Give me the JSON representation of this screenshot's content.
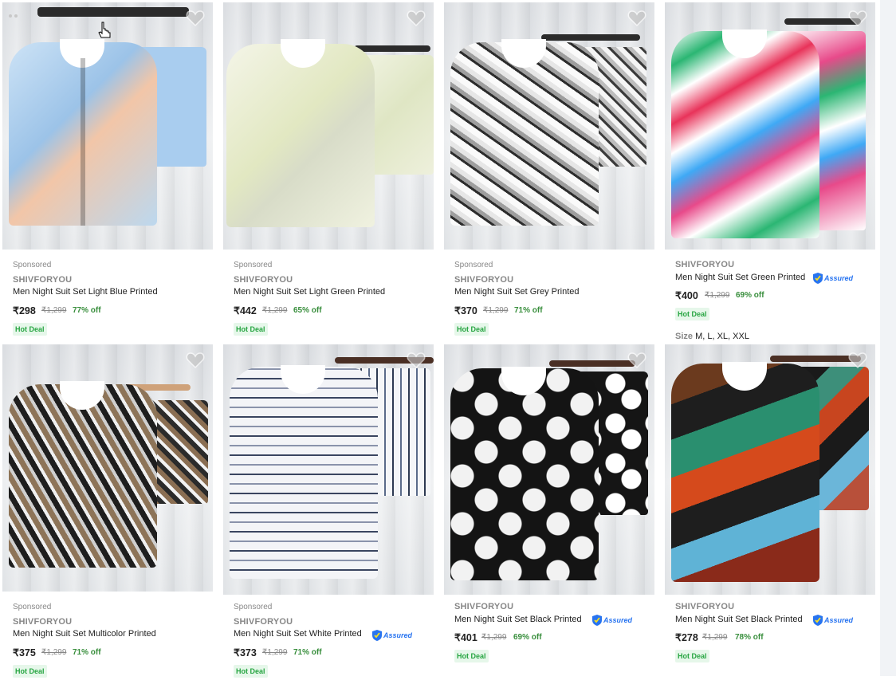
{
  "products": [
    {
      "sponsored": "Sponsored",
      "brand": "SHIVFORYOU",
      "title": "Men Night Suit Set Light Blue Printed",
      "price": "₹298",
      "mrp": "₹1,299",
      "off": "77% off",
      "deal": "Hot Deal",
      "assured": "",
      "shirt_color": "#bcd8ef",
      "shorts_color": "#a9cdef"
    },
    {
      "sponsored": "Sponsored",
      "brand": "SHIVFORYOU",
      "title": "Men Night Suit Set Light Green Printed",
      "price": "₹442",
      "mrp": "₹1,299",
      "off": "65% off",
      "deal": "Hot Deal",
      "assured": "",
      "shirt_color": "#eef0dc",
      "shorts_color": "#e8ecd6"
    },
    {
      "sponsored": "Sponsored",
      "brand": "SHIVFORYOU",
      "title": "Men Night Suit Set Grey Printed",
      "price": "₹370",
      "mrp": "₹1,299",
      "off": "71% off",
      "deal": "Hot Deal",
      "assured": "",
      "shirt_color": "#d6d6d6",
      "shorts_color": "#c9c9c9"
    },
    {
      "sponsored": "",
      "brand": "SHIVFORYOU",
      "title": "Men Night Suit Set Green Printed",
      "price": "₹400",
      "mrp": "₹1,299",
      "off": "69% off",
      "deal": "Hot Deal",
      "assured": "Assured",
      "shirt_color": "#f1f4f2",
      "shorts_color": "#f3f3f3",
      "size_label": "Size",
      "sizes": "M, L, XL, XXL"
    },
    {
      "sponsored": "Sponsored",
      "brand": "SHIVFORYOU",
      "title": "Men Night Suit Set Multicolor Printed",
      "price": "₹375",
      "mrp": "₹1,299",
      "off": "71% off",
      "deal": "Hot Deal",
      "assured": "",
      "shirt_color": "#6e6e6e",
      "shorts_color": "#8a7a66"
    },
    {
      "sponsored": "Sponsored",
      "brand": "SHIVFORYOU",
      "title": "Men Night Suit Set White Printed",
      "price": "₹373",
      "mrp": "₹1,299",
      "off": "71% off",
      "deal": "Hot Deal",
      "assured": "Assured",
      "shirt_color": "#e5e6ea",
      "shorts_color": "#e5e6ea"
    },
    {
      "sponsored": "",
      "brand": "SHIVFORYOU",
      "title": "Men Night Suit Set Black Printed",
      "price": "₹401",
      "mrp": "₹1,299",
      "off": "69% off",
      "deal": "Hot Deal",
      "assured": "Assured",
      "shirt_color": "#1c1c1c",
      "shorts_color": "#1c1c1c"
    },
    {
      "sponsored": "",
      "brand": "SHIVFORYOU",
      "title": "Men Night Suit Set Black Printed",
      "price": "₹278",
      "mrp": "₹1,299",
      "off": "78% off",
      "deal": "Hot Deal",
      "assured": "Assured",
      "shirt_color": "#2a2a2a",
      "shorts_color": "#2a2a2a"
    }
  ],
  "colors": {
    "accent": "#2874f0",
    "discount": "#388e3c",
    "deal_bg": "#e6f7ea",
    "deal_text": "#26a541"
  },
  "icons": {
    "wishlist": "heart-icon",
    "assured": "assured-badge-icon",
    "cursor": "hand-cursor-icon"
  }
}
